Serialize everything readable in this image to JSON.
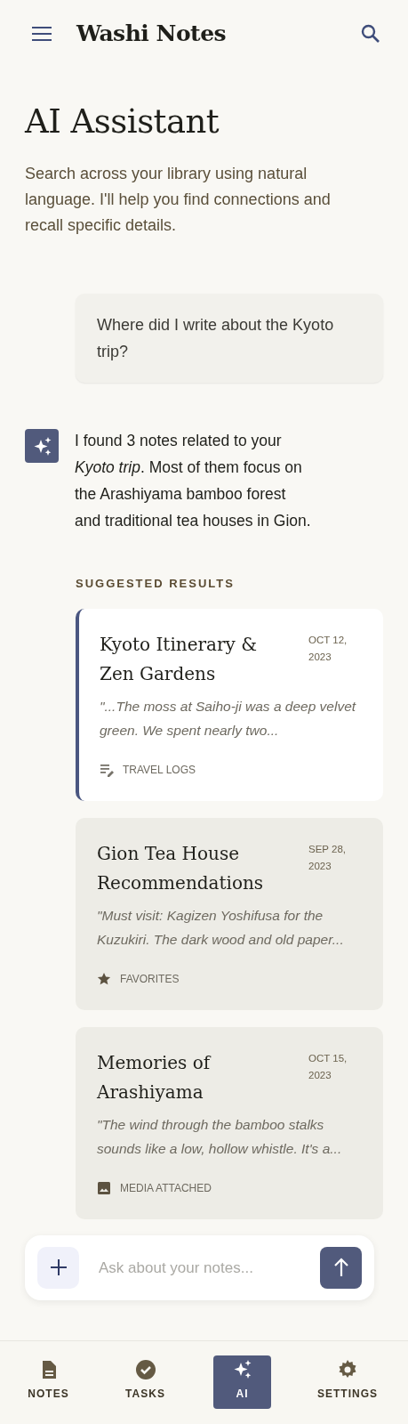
{
  "app_bar": {
    "title": "Washi Notes"
  },
  "page": {
    "title": "AI Assistant",
    "description": "Search across your library using natural language. I'll help you find connections and recall specific details."
  },
  "user_message": {
    "text": "Where did I write about the Kyoto trip?"
  },
  "ai_message": {
    "text": "I found 3 notes related to your *Kyoto trip*. Most of them focus on the Arashiyama bamboo forest and traditional tea houses in Gion."
  },
  "results_heading": "SUGGESTED RESULTS",
  "results": [
    {
      "title": "Kyoto Itinerary & Zen Gardens",
      "date": "OCT 12, 2023",
      "excerpt": "\"...The moss at Saiho-ji was a deep velvet green. We spent nearly two...",
      "tag": "TRAVEL LOGS",
      "kind": "notes",
      "selected": true
    },
    {
      "title": "Gion Tea House Recommendations",
      "date": "SEP 28, 2023",
      "excerpt": "\"Must visit: Kagizen Yoshifusa for the Kuzukiri. The dark wood and old paper...",
      "tag": "FAVORITES",
      "kind": "star",
      "selected": false
    },
    {
      "title": "Memories of Arashiyama",
      "date": "OCT 15, 2023",
      "excerpt": "\"The wind through the bamboo stalks sounds like a low, hollow whistle. It's a...",
      "tag": "MEDIA ATTACHED",
      "kind": "image",
      "selected": false
    }
  ],
  "composer": {
    "placeholder": "Ask about your notes..."
  },
  "nav": [
    {
      "label": "NOTES",
      "kind": "notes",
      "selected": false
    },
    {
      "label": "TASKS",
      "kind": "tasks",
      "selected": false
    },
    {
      "label": "AI",
      "kind": "ai",
      "selected": true
    },
    {
      "label": "SETTINGS",
      "kind": "settings",
      "selected": false
    }
  ]
}
